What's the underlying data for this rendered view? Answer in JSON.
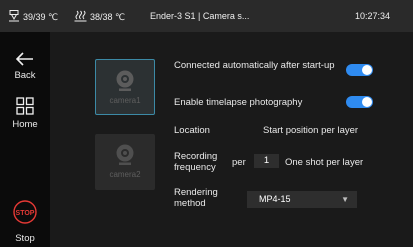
{
  "status_bar": {
    "nozzle_temp": "39/39 ℃",
    "bed_temp": "38/38 ℃",
    "title": "Ender-3 S1 | Camera s...",
    "time": "10:27:34",
    "nozzle_icon": "nozzle-icon",
    "bed_icon": "heated-bed-icon"
  },
  "sidebar": {
    "back_label": "Back",
    "home_label": "Home",
    "stop_label": "Stop",
    "stop_icon_text": "STOP",
    "stop_color": "#e53935"
  },
  "cameras": [
    {
      "label": "camera1",
      "selected": true
    },
    {
      "label": "camera2",
      "selected": false
    }
  ],
  "settings": {
    "auto_connect_label": "Connected automatically after start-up",
    "auto_connect_on": true,
    "timelapse_label": "Enable timelapse photography",
    "timelapse_on": true,
    "location_label": "Location",
    "location_value": "Start position per layer",
    "frequency_label_line1": "Recording",
    "frequency_label_line2": "frequency",
    "frequency_prefix": "per",
    "frequency_value": "1",
    "frequency_suffix": "One shot per layer",
    "render_label_line1": "Rendering",
    "render_label_line2": "method",
    "render_value": "MP4-15"
  },
  "colors": {
    "toggle_on": "#2f8bf0",
    "selected_border": "#3c8aa6"
  }
}
